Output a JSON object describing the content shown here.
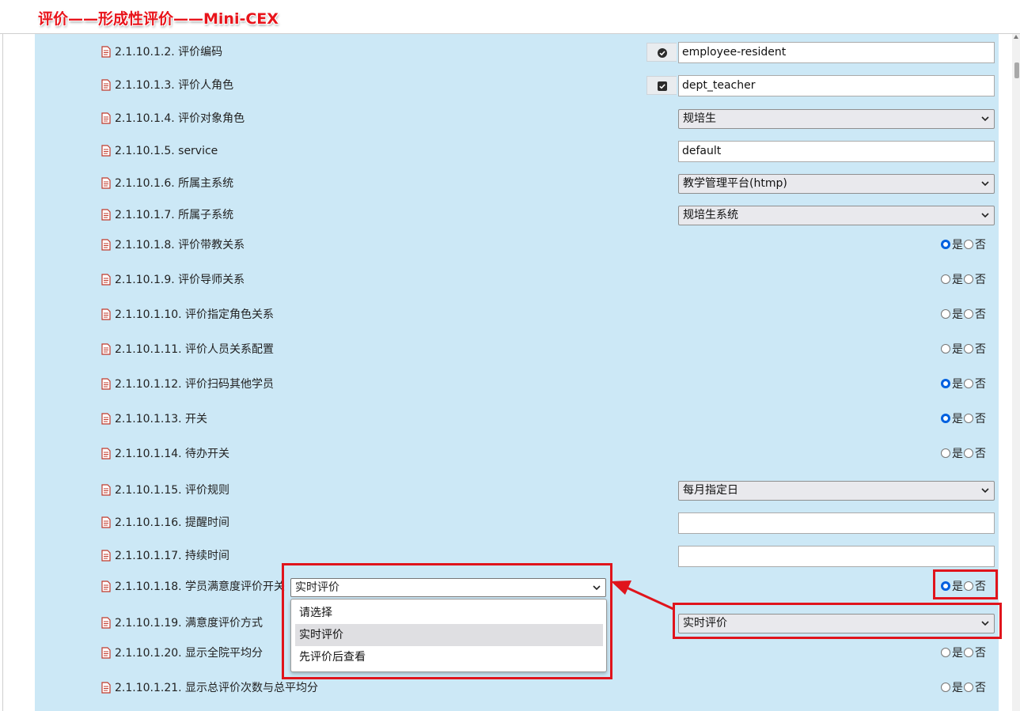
{
  "page_title": "评价——形成性评价——Mini-CEX",
  "rows": [
    {
      "label": "2.1.10.1.2. 评价编码",
      "control": "input-icon",
      "icon": "check-circle-icon",
      "value": "employee-resident"
    },
    {
      "label": "2.1.10.1.3. 评价人角色",
      "control": "input-icon",
      "icon": "checkbox-checked-icon",
      "value": "dept_teacher"
    },
    {
      "label": "2.1.10.1.4. 评价对象角色",
      "control": "select",
      "value": "规培生"
    },
    {
      "label": "2.1.10.1.5. service",
      "control": "input",
      "value": "default"
    },
    {
      "label": "2.1.10.1.6. 所属主系统",
      "control": "select",
      "value": "教学管理平台(htmp)"
    },
    {
      "label": "2.1.10.1.7. 所属子系统",
      "control": "select",
      "value": "规培生系统"
    },
    {
      "label": "2.1.10.1.8. 评价带教关系",
      "control": "radio",
      "selected": "yes"
    },
    {
      "label": "2.1.10.1.9. 评价导师关系",
      "control": "radio",
      "selected": "none"
    },
    {
      "label": "2.1.10.1.10. 评价指定角色关系",
      "control": "radio",
      "selected": "none"
    },
    {
      "label": "2.1.10.1.11. 评价人员关系配置",
      "control": "radio",
      "selected": "none"
    },
    {
      "label": "2.1.10.1.12. 评价扫码其他学员",
      "control": "radio",
      "selected": "yes"
    },
    {
      "label": "2.1.10.1.13. 开关",
      "control": "radio",
      "selected": "yes"
    },
    {
      "label": "2.1.10.1.14. 待办开关",
      "control": "radio",
      "selected": "none"
    },
    {
      "label": "2.1.10.1.15. 评价规则",
      "control": "select",
      "value": "每月指定日"
    },
    {
      "label": "2.1.10.1.16. 提醒时间",
      "control": "input",
      "value": ""
    },
    {
      "label": "2.1.10.1.17. 持续时间",
      "control": "input",
      "value": ""
    },
    {
      "label": "2.1.10.1.18. 学员满意度评价开关",
      "control": "radio",
      "selected": "yes"
    },
    {
      "label": "2.1.10.1.19. 满意度评价方式",
      "control": "select",
      "value": "实时评价"
    },
    {
      "label": "2.1.10.1.20. 显示全院平均分",
      "control": "radio",
      "selected": "none"
    },
    {
      "label": "2.1.10.1.21. 显示总评价次数与总平均分",
      "control": "radio",
      "selected": "none"
    }
  ],
  "radio_labels": {
    "yes": "是",
    "no": "否"
  },
  "dropdown": {
    "selected": "实时评价",
    "options": [
      "请选择",
      "实时评价",
      "先评价后查看"
    ],
    "highlighted": "实时评价"
  },
  "colors": {
    "panel": "#cce8f6",
    "annotation": "#e0141c",
    "radio_checked": "#0060df",
    "doc_icon": "#c0392b"
  }
}
